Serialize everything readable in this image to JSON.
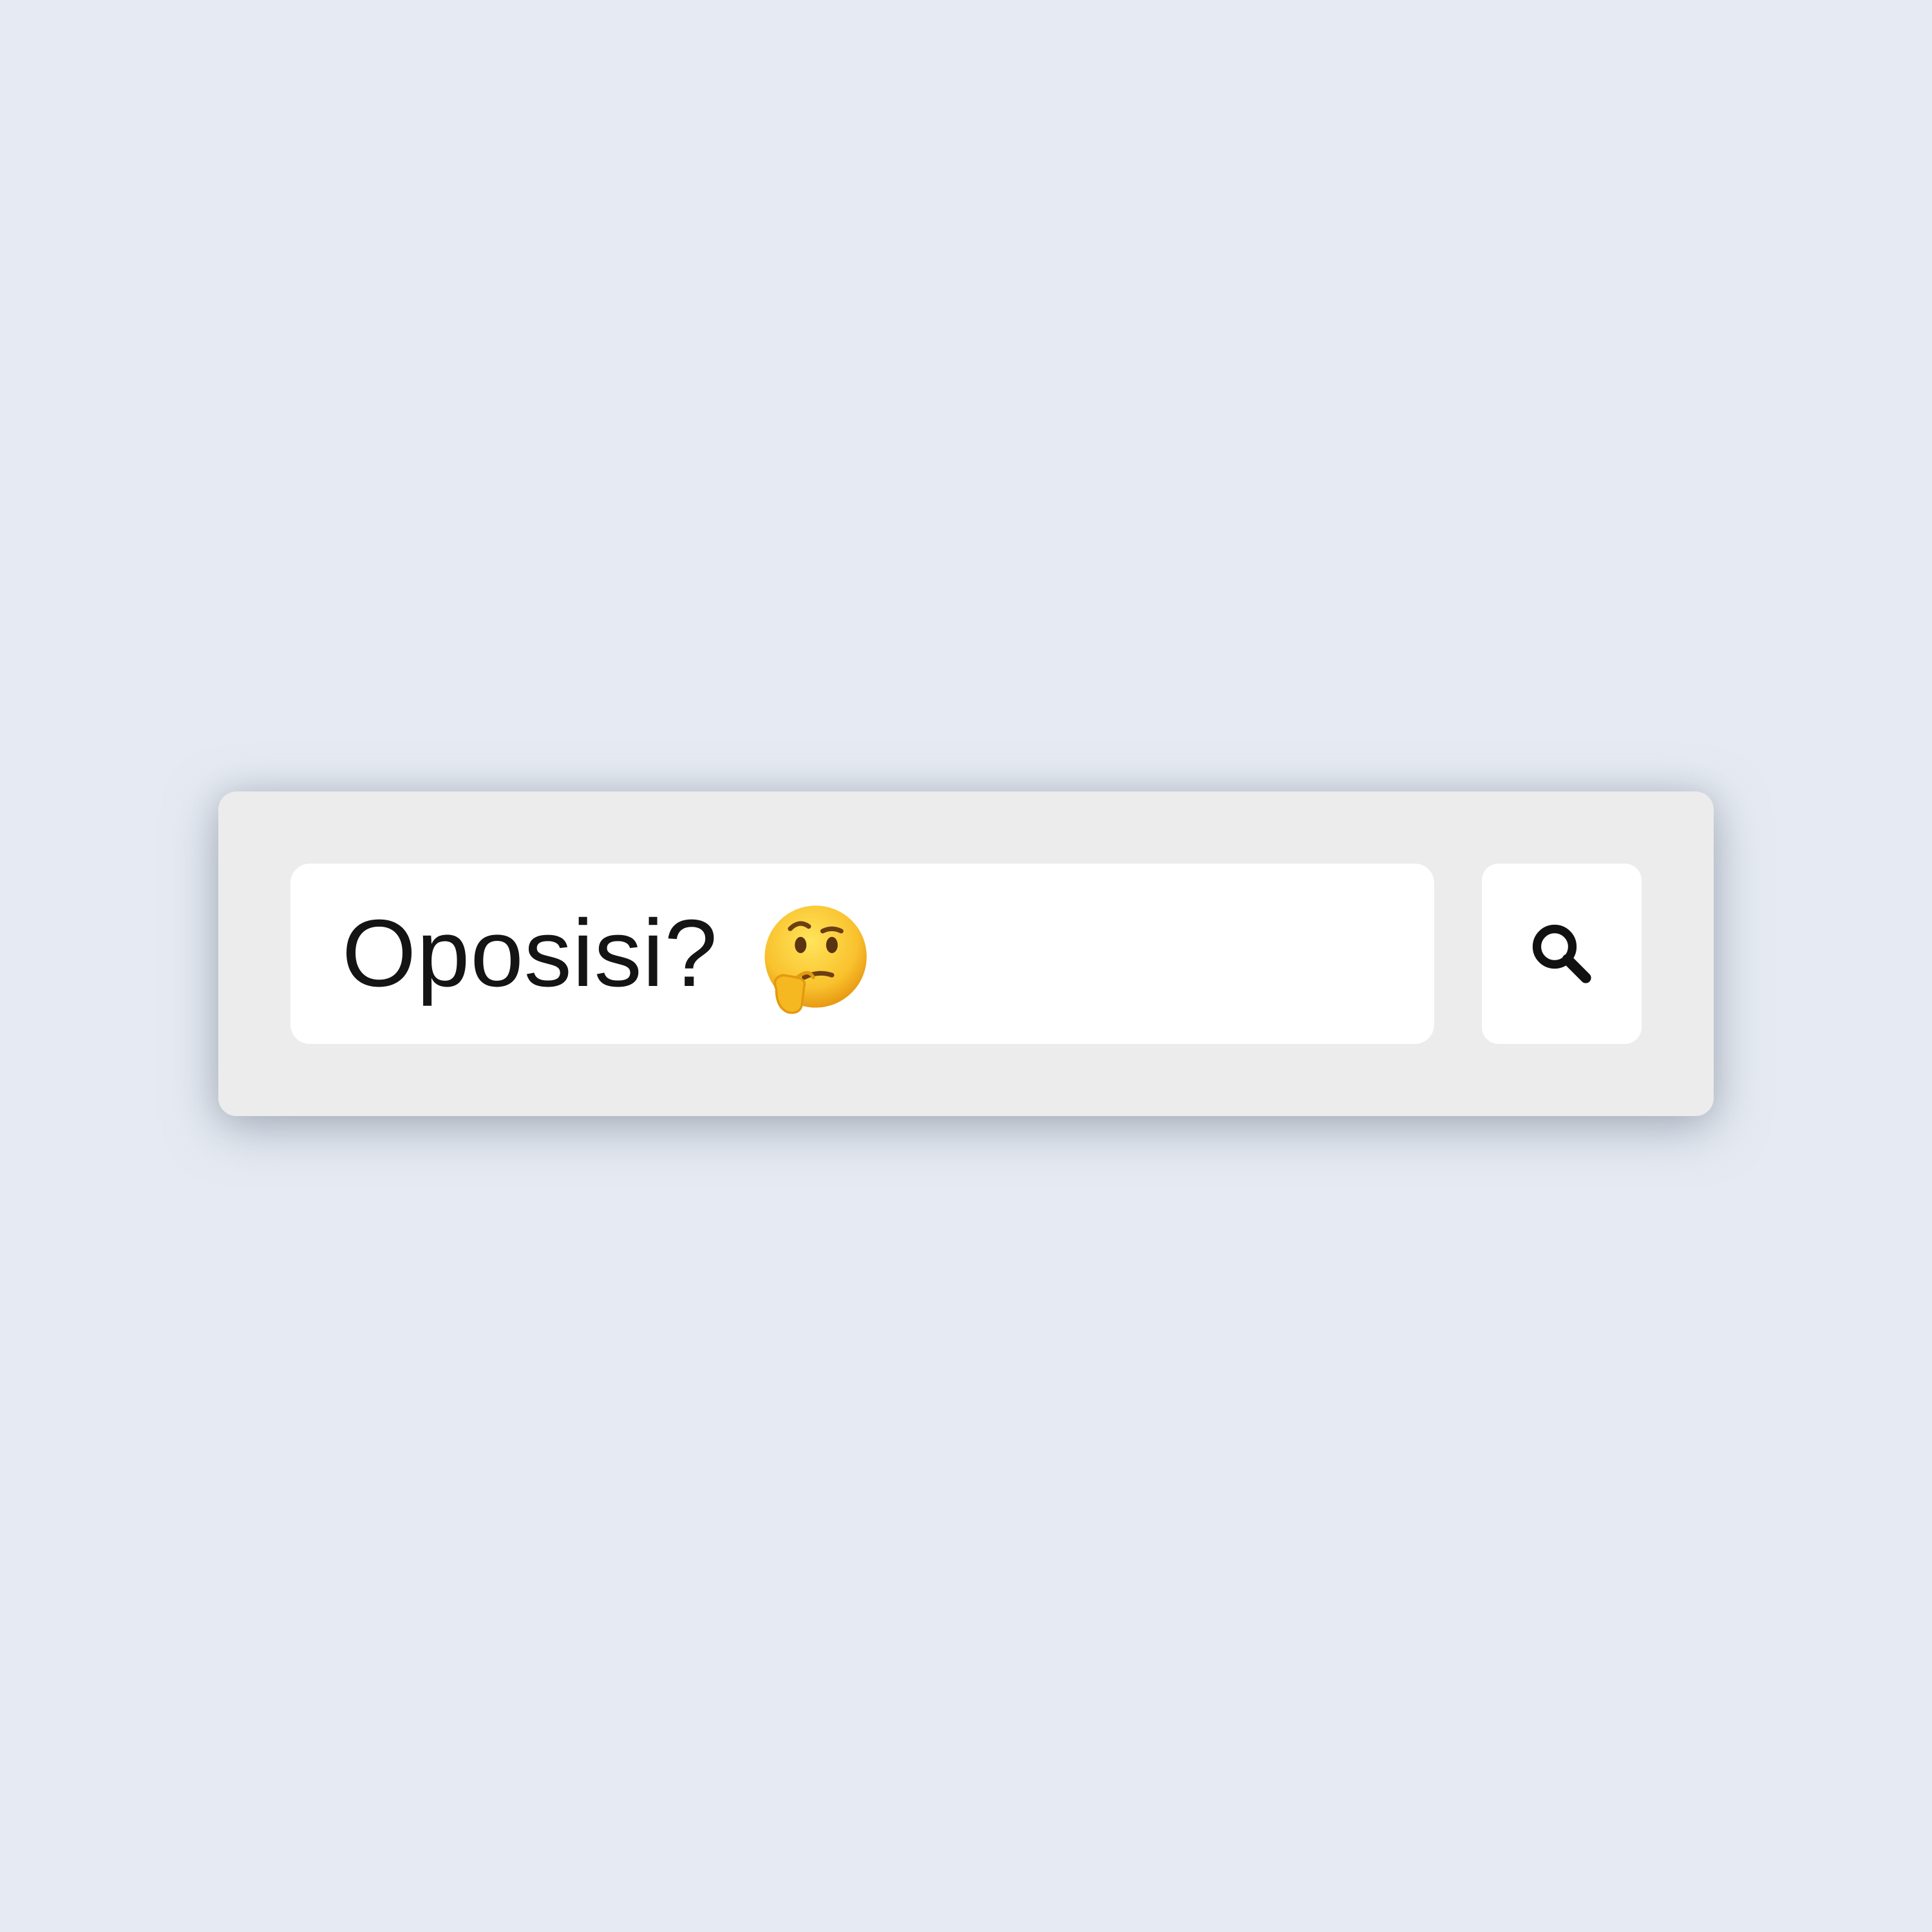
{
  "search": {
    "query": "Oposisi?",
    "query_emoji": "thinking-face-emoji",
    "button_icon": "search-icon"
  },
  "colors": {
    "background": "#e6ebf3",
    "card": "#ececec",
    "field": "#ffffff",
    "text": "#141414",
    "emoji_face": "#f9c22e"
  }
}
